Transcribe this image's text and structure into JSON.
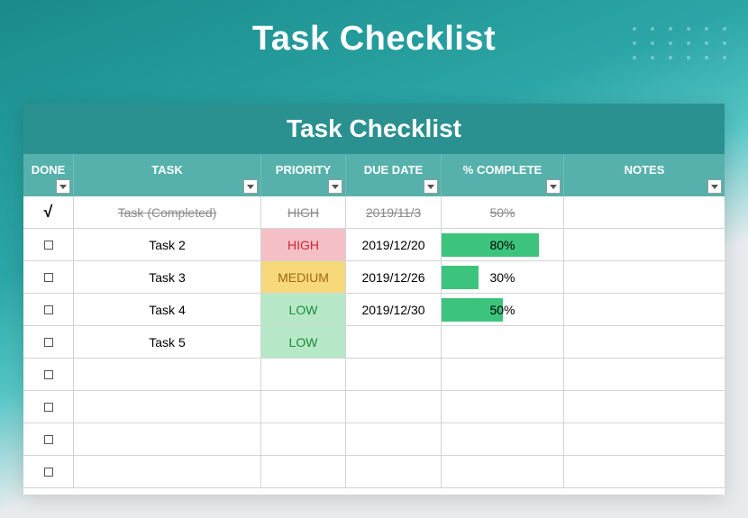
{
  "page_title": "Task Checklist",
  "sheet_title": "Task Checklist",
  "columns": {
    "done": "DONE",
    "task": "TASK",
    "priority": "PRIORITY",
    "due": "DUE DATE",
    "complete": "% COMPLETE",
    "notes": "NOTES"
  },
  "rows": [
    {
      "done": true,
      "task": "Task (Completed)",
      "priority": "HIGH",
      "due": "2019/11/3",
      "pct": 50,
      "pct_label": "50%",
      "notes": "",
      "completed": true
    },
    {
      "done": false,
      "task": "Task 2",
      "priority": "HIGH",
      "due": "2019/12/20",
      "pct": 80,
      "pct_label": "80%",
      "notes": "",
      "completed": false
    },
    {
      "done": false,
      "task": "Task 3",
      "priority": "MEDIUM",
      "due": "2019/12/26",
      "pct": 30,
      "pct_label": "30%",
      "notes": "",
      "completed": false
    },
    {
      "done": false,
      "task": "Task 4",
      "priority": "LOW",
      "due": "2019/12/30",
      "pct": 50,
      "pct_label": "50%",
      "notes": "",
      "completed": false
    },
    {
      "done": false,
      "task": "Task 5",
      "priority": "LOW",
      "due": "",
      "pct": null,
      "pct_label": "",
      "notes": "",
      "completed": false
    },
    {
      "done": false,
      "task": "",
      "priority": "",
      "due": "",
      "pct": null,
      "pct_label": "",
      "notes": "",
      "completed": false
    },
    {
      "done": false,
      "task": "",
      "priority": "",
      "due": "",
      "pct": null,
      "pct_label": "",
      "notes": "",
      "completed": false
    },
    {
      "done": false,
      "task": "",
      "priority": "",
      "due": "",
      "pct": null,
      "pct_label": "",
      "notes": "",
      "completed": false
    },
    {
      "done": false,
      "task": "",
      "priority": "",
      "due": "",
      "pct": null,
      "pct_label": "",
      "notes": "",
      "completed": false
    }
  ],
  "chart_data": {
    "type": "table",
    "title": "Task Checklist",
    "columns": [
      "DONE",
      "TASK",
      "PRIORITY",
      "DUE DATE",
      "% COMPLETE",
      "NOTES"
    ],
    "rows": [
      [
        true,
        "Task (Completed)",
        "HIGH",
        "2019/11/3",
        50,
        ""
      ],
      [
        false,
        "Task 2",
        "HIGH",
        "2019/12/20",
        80,
        ""
      ],
      [
        false,
        "Task 3",
        "MEDIUM",
        "2019/12/26",
        30,
        ""
      ],
      [
        false,
        "Task 4",
        "LOW",
        "2019/12/30",
        50,
        ""
      ],
      [
        false,
        "Task 5",
        "LOW",
        "",
        null,
        ""
      ]
    ]
  }
}
